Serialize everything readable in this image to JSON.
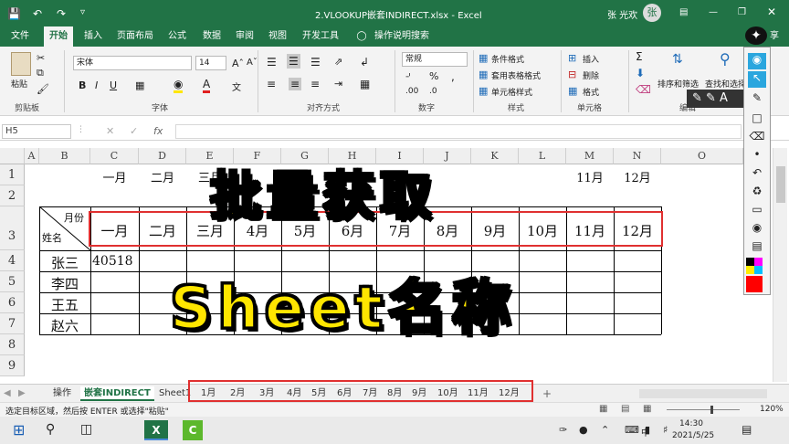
{
  "window": {
    "title": "2.VLOOKUP嵌套INDIRECT.xlsx  -  Excel",
    "user": "张 光欢",
    "avatar_letter": "张"
  },
  "menu": {
    "tabs": [
      "文件",
      "开始",
      "插入",
      "页面布局",
      "公式",
      "数据",
      "审阅",
      "视图",
      "开发工具"
    ],
    "help": "操作说明搜索",
    "share": "享"
  },
  "ribbon": {
    "paste": "粘贴",
    "clipboard": "剪贴板",
    "font_name": "宋体",
    "font_size": "14",
    "font_group": "字体",
    "bold": "B",
    "italic": "I",
    "underline": "U",
    "align_group": "对齐方式",
    "number_format": "常规",
    "number_group": "数字",
    "cond_format": "条件格式",
    "table_format": "套用表格格式",
    "cell_style": "单元格样式",
    "style_group": "样式",
    "insert": "插入",
    "delete": "删除",
    "format": "格式",
    "cells_group": "单元格",
    "sort": "排序和筛选",
    "find": "查找和选择",
    "edit_group": "编辑"
  },
  "formula_bar": {
    "name_box": "H5",
    "fx": "fx"
  },
  "columns": [
    "A",
    "B",
    "C",
    "D",
    "E",
    "F",
    "G",
    "H",
    "I",
    "J",
    "K",
    "L",
    "M",
    "N",
    "O"
  ],
  "rows": [
    "1",
    "2",
    "3",
    "4",
    "5",
    "6",
    "7",
    "8",
    "9"
  ],
  "row1_months": [
    "一月",
    "二月",
    "三月",
    "11月",
    "12月"
  ],
  "table": {
    "header_month": "月份",
    "header_name": "姓名",
    "months": [
      "一月",
      "二月",
      "三月",
      "4月",
      "5月",
      "6月",
      "7月",
      "8月",
      "9月",
      "10月",
      "11月",
      "12月"
    ],
    "names": [
      "张三",
      "李四",
      "王五",
      "赵六"
    ],
    "value_zhangsan": "40518"
  },
  "overlay": {
    "line1": "批量获取",
    "line2": "Sheet名称"
  },
  "sheets": {
    "fixed": [
      "操作",
      "嵌套INDIRECT",
      "Sheet1"
    ],
    "months": [
      "1月",
      "2月",
      "3月",
      "4月",
      "5月",
      "6月",
      "7月",
      "8月",
      "9月",
      "10月",
      "11月",
      "12月"
    ],
    "add": "+"
  },
  "status": {
    "message": "选定目标区域，然后按 ENTER 或选择\"粘贴\"",
    "zoom": "120%"
  },
  "taskbar": {
    "time": "14:30",
    "date": "2021/5/25",
    "lang": "中"
  },
  "colors": {
    "excel_green": "#217346",
    "overlay_yellow": "#ffe600",
    "highlight_red": "#e03030"
  }
}
